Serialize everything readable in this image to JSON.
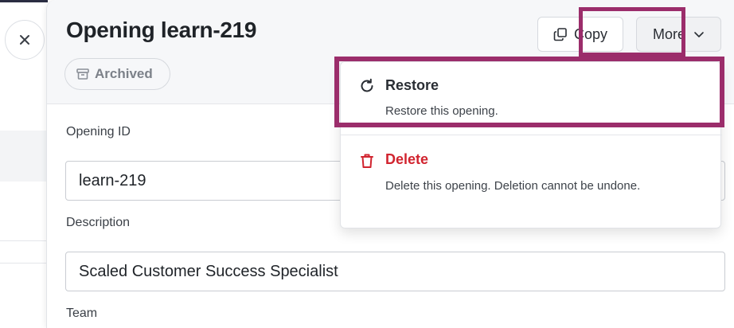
{
  "panel": {
    "title": "Opening learn-219",
    "status_badge": "Archived",
    "copy_label": "Copy",
    "more_label": "More"
  },
  "fields": [
    {
      "label": "Opening ID",
      "value": "learn-219"
    },
    {
      "label": "Description",
      "value": "Scaled Customer Success Specialist"
    },
    {
      "label": "Team",
      "value": ""
    }
  ],
  "more_menu": {
    "items": [
      {
        "label": "Restore",
        "description": "Restore this opening.",
        "icon": "restore-icon",
        "color": "#2a2e34"
      },
      {
        "label": "Delete",
        "description": "Delete this opening. Deletion cannot be undone.",
        "icon": "trash-icon",
        "color": "#d1242f"
      }
    ]
  },
  "highlight_color": "#9b2d6b",
  "background": {
    "close_icon": "close-icon"
  }
}
